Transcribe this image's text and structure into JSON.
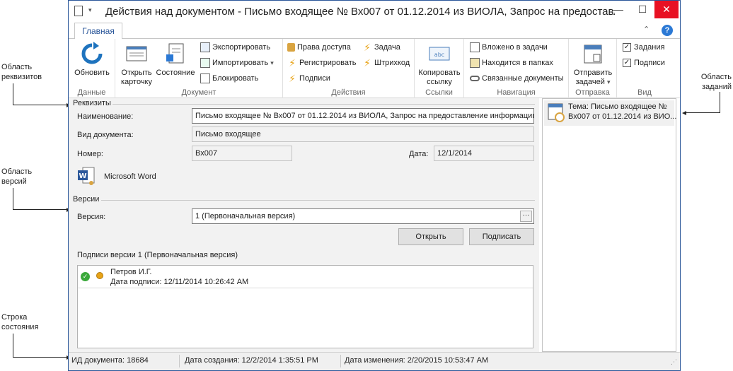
{
  "annotations": {
    "details_area": "Область реквизитов",
    "versions_area": "Область версий",
    "status_bar": "Строка состояния",
    "tasks_area": "Область заданий"
  },
  "window": {
    "title": "Действия над документом - Письмо входящее № Вх007 от 01.12.2014 из ВИОЛА,  Запрос на предоставлени...",
    "minimize": "—",
    "maximize": "☐",
    "close": "✕",
    "help": "?"
  },
  "ribbon": {
    "tab_main": "Главная",
    "groups": {
      "data": {
        "label": "Данные",
        "refresh": "Обновить"
      },
      "document": {
        "label": "Документ",
        "open_card_1": "Открыть",
        "open_card_2": "карточку",
        "state": "Состояние",
        "export": "Экспортировать",
        "import": "Импортировать",
        "block": "Блокировать"
      },
      "actions": {
        "label": "Действия",
        "access_rights": "Права доступа",
        "register": "Регистрировать",
        "signatures": "Подписи",
        "task": "Задача",
        "barcode": "Штрихкод"
      },
      "links": {
        "label": "Ссылки",
        "copy_link_1": "Копировать",
        "copy_link_2": "ссылку"
      },
      "navigation": {
        "label": "Навигация",
        "in_tasks": "Вложено в задачи",
        "in_folders": "Находится в папках",
        "related": "Связанные документы"
      },
      "send": {
        "label": "Отправка",
        "send_task_1": "Отправить",
        "send_task_2": "задачей"
      },
      "view": {
        "label": "Вид",
        "tasks": "Задания",
        "signatures": "Подписи"
      }
    }
  },
  "details": {
    "section": "Реквизиты",
    "name_label": "Наименование:",
    "name_value": "Письмо входящее № Вх007 от 01.12.2014 из ВИОЛА,  Запрос на предоставление информации|",
    "doc_type_label": "Вид документа:",
    "doc_type_value": "Письмо входящее",
    "number_label": "Номер:",
    "number_value": "Вх007",
    "date_label": "Дата:",
    "date_value": "12/1/2014",
    "app_name": "Microsoft Word"
  },
  "versions": {
    "section": "Версии",
    "version_label": "Версия:",
    "version_value": "1 (Первоначальная версия)",
    "browse": "···",
    "open_button": "Открыть",
    "sign_button": "Подписать",
    "signatures_header": "Подписи версии 1 (Первоначальная версия)",
    "signatures": [
      {
        "signer": "Петров И.Г.",
        "date": "Дата подписи: 12/11/2014 10:26:42 AM"
      }
    ]
  },
  "tasks": {
    "items": [
      {
        "line1": "Тема: Письмо входящее №",
        "line2": "Вх007 от 01.12.2014 из ВИО..."
      }
    ]
  },
  "status": {
    "doc_id": "ИД документа: 18684",
    "created": "Дата создания: 12/2/2014 1:35:51 PM",
    "modified": "Дата изменения: 2/20/2015 10:53:47 AM"
  },
  "colors": {
    "accent": "#2b579a",
    "pane_bg": "#f2f2f2",
    "status_ok": "#3aa83a",
    "lightning": "#e8a317"
  }
}
